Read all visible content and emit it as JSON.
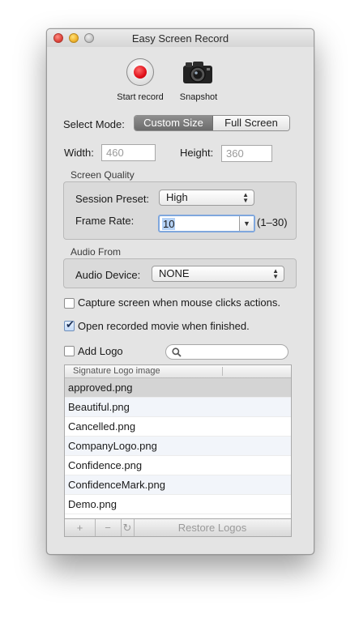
{
  "window": {
    "title": "Easy Screen Record"
  },
  "toolbar": {
    "start_record_label": "Start record",
    "snapshot_label": "Snapshot"
  },
  "mode": {
    "label": "Select Mode:",
    "options": [
      "Custom Size",
      "Full Screen"
    ],
    "selected": "Custom Size"
  },
  "size": {
    "width_label": "Width:",
    "width_value": "460",
    "height_label": "Height:",
    "height_value": "360"
  },
  "quality": {
    "title": "Screen  Quality",
    "preset_label": "Session Preset:",
    "preset_value": "High",
    "frame_rate_label": "Frame Rate:",
    "frame_rate_value": "10",
    "frame_rate_range": "(1–30)"
  },
  "audio": {
    "title": "Audio From",
    "device_label": "Audio Device:",
    "device_value": "NONE"
  },
  "options": {
    "capture_clicks_label": "Capture screen when mouse clicks actions.",
    "capture_clicks_checked": false,
    "open_movie_label": "Open recorded movie when finished.",
    "open_movie_checked": true,
    "add_logo_label": "Add Logo",
    "add_logo_checked": false
  },
  "search": {
    "icon": "search-icon"
  },
  "logos": {
    "column_header": "Signature Logo image",
    "items": [
      "approved.png",
      "Beautiful.png",
      "Cancelled.png",
      "CompanyLogo.png",
      "Confidence.png",
      "ConfidenceMark.png",
      "Demo.png"
    ],
    "selected": "approved.png",
    "add_label": "+",
    "remove_label": "−",
    "refresh_icon": "↻",
    "restore_label": "Restore Logos"
  }
}
